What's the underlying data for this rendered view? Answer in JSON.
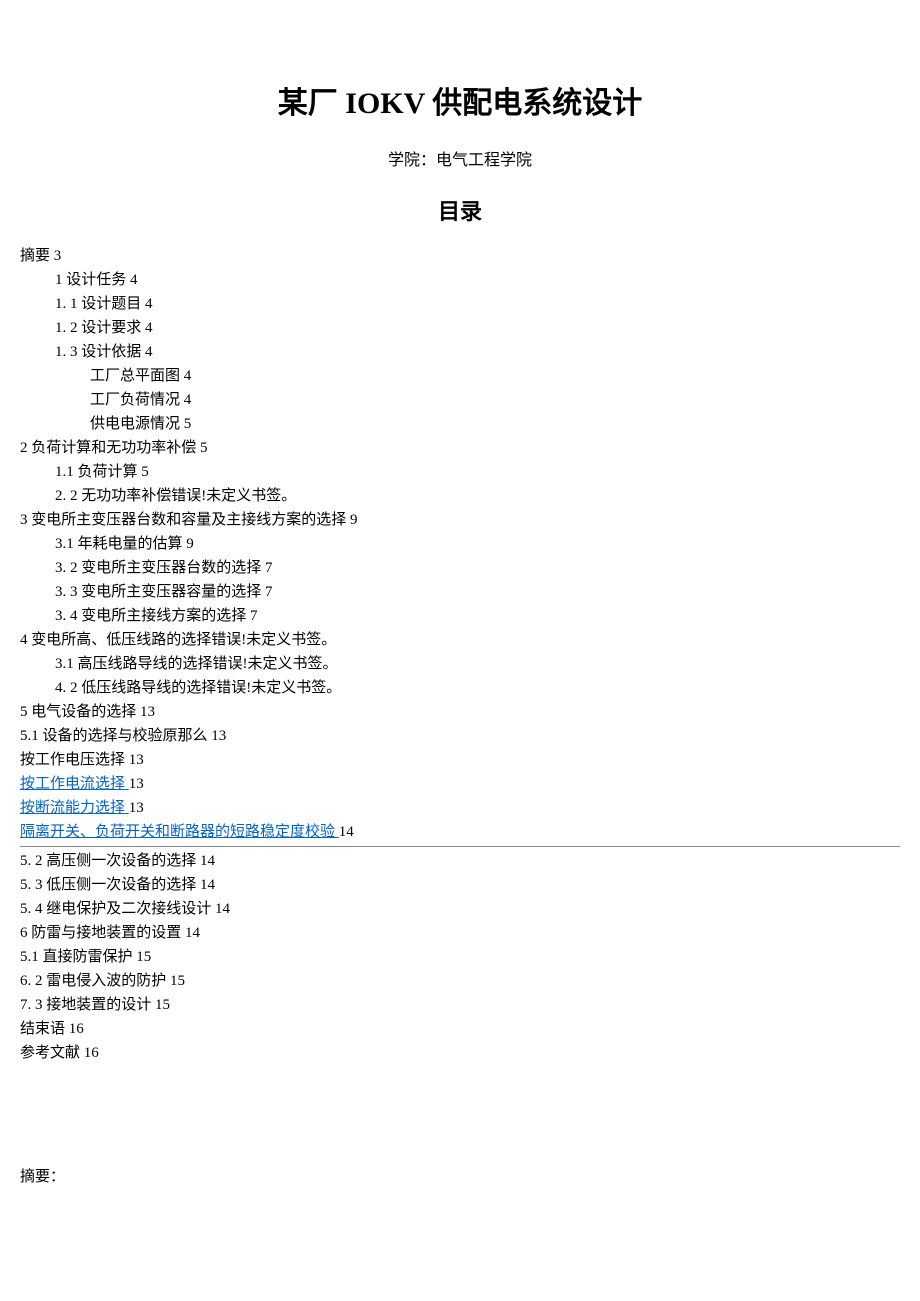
{
  "title": "某厂 IOKV 供配电系统设计",
  "subtitle": "学院：电气工程学院",
  "toc_heading": "目录",
  "toc": [
    {
      "text": "摘要 3",
      "indent": 0,
      "link": false
    },
    {
      "text": "1 设计任务 4",
      "indent": 1,
      "link": false
    },
    {
      "text": "1. 1 设计题目 4",
      "indent": 1,
      "link": false
    },
    {
      "text": "1. 2 设计要求 4",
      "indent": 1,
      "link": false
    },
    {
      "text": "1.  3 设计依据 4",
      "indent": 1,
      "link": false
    },
    {
      "text": "工厂总平面图 4",
      "indent": 2,
      "link": false
    },
    {
      "text": "工厂负荷情况 4",
      "indent": 2,
      "link": false
    },
    {
      "text": "供电电源情况 5",
      "indent": 2,
      "link": false
    },
    {
      "text": "2 负荷计算和无功功率补偿 5",
      "indent": 0,
      "link": false
    },
    {
      "text": "1.1   负荷计算 5",
      "indent": 1,
      "link": false
    },
    {
      "text": "2.  2 无功功率补偿错误!未定义书签。",
      "indent": 1,
      "link": false
    },
    {
      "text": "3 变电所主变压器台数和容量及主接线方案的选择 9",
      "indent": 0,
      "link": false
    },
    {
      "text": "3.1 年耗电量的估算 9",
      "indent": 1,
      "link": false
    },
    {
      "text": "3.  2 变电所主变压器台数的选择 7",
      "indent": 1,
      "link": false
    },
    {
      "text": "3.  3 变电所主变压器容量的选择 7",
      "indent": 1,
      "link": false
    },
    {
      "text": "3.  4 变电所主接线方案的选择 7",
      "indent": 1,
      "link": false
    },
    {
      "text": "4 变电所高、低压线路的选择错误!未定义书签。",
      "indent": 0,
      "link": false
    },
    {
      "text": "3.1   高压线路导线的选择错误!未定义书签。",
      "indent": 1,
      "link": false
    },
    {
      "text": "4.  2 低压线路导线的选择错误!未定义书签。",
      "indent": 1,
      "link": false
    },
    {
      "text": "5 电气设备的选择 13",
      "indent": 0,
      "link": false
    },
    {
      "text": "5.1 设备的选择与校验原那么 13",
      "indent": 0,
      "link": false
    },
    {
      "text": "按工作电压选择 13",
      "indent": 0,
      "link": false
    },
    {
      "text_link": "按工作电流选择 ",
      "text_after": "13",
      "indent": 0,
      "link": true
    },
    {
      "text_link": "按断流能力选择 ",
      "text_after": "13",
      "indent": 0,
      "link": true
    },
    {
      "text_link": "隔离开关、负荷开关和断路器的短路稳定度校验 ",
      "text_after": "14",
      "indent": 0,
      "link": true
    }
  ],
  "toc_after_hr": [
    {
      "text": "5.  2 高压侧一次设备的选择 14",
      "indent": 0
    },
    {
      "text": "5.  3 低压侧一次设备的选择 14",
      "indent": 0
    },
    {
      "text": "5.  4 继电保护及二次接线设计 14",
      "indent": 0
    },
    {
      "text": "6 防雷与接地装置的设置 14",
      "indent": 0
    },
    {
      "text": "5.1   直接防雷保护 15",
      "indent": 0
    },
    {
      "text": "6.  2 雷电侵入波的防护 15",
      "indent": 0
    },
    {
      "text": "7.  3 接地装置的设计 15",
      "indent": 0
    },
    {
      "text": "结束语 16",
      "indent": 0
    },
    {
      "text": "参考文献 16",
      "indent": 0
    }
  ],
  "abstract_heading": "摘要："
}
